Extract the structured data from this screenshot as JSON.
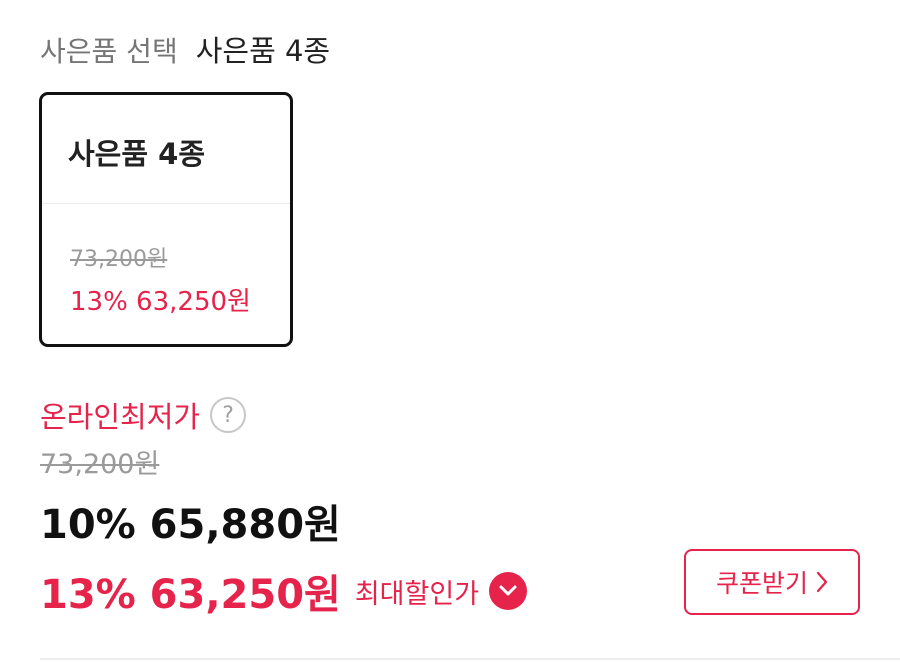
{
  "gift": {
    "header_label": "사은품 선택",
    "header_value": "사은품 4종"
  },
  "option_card": {
    "title": "사은품 4종",
    "original_price": "73,200원",
    "sale_price": "13% 63,250원"
  },
  "pricing": {
    "lowest_label": "온라인최저가",
    "help_icon": "question-circle-icon",
    "help_symbol": "?",
    "original_price": "73,200원",
    "discount_price": "10% 65,880원",
    "max_discount_price": "13% 63,250원",
    "max_discount_label": "최대할인가",
    "expand_icon": "chevron-down-icon"
  },
  "coupon": {
    "button_label": "쿠폰받기",
    "arrow_icon": "chevron-right-icon"
  },
  "colors": {
    "accent": "#e5234b",
    "text_primary": "#111111",
    "text_muted": "#9a9a9a"
  }
}
